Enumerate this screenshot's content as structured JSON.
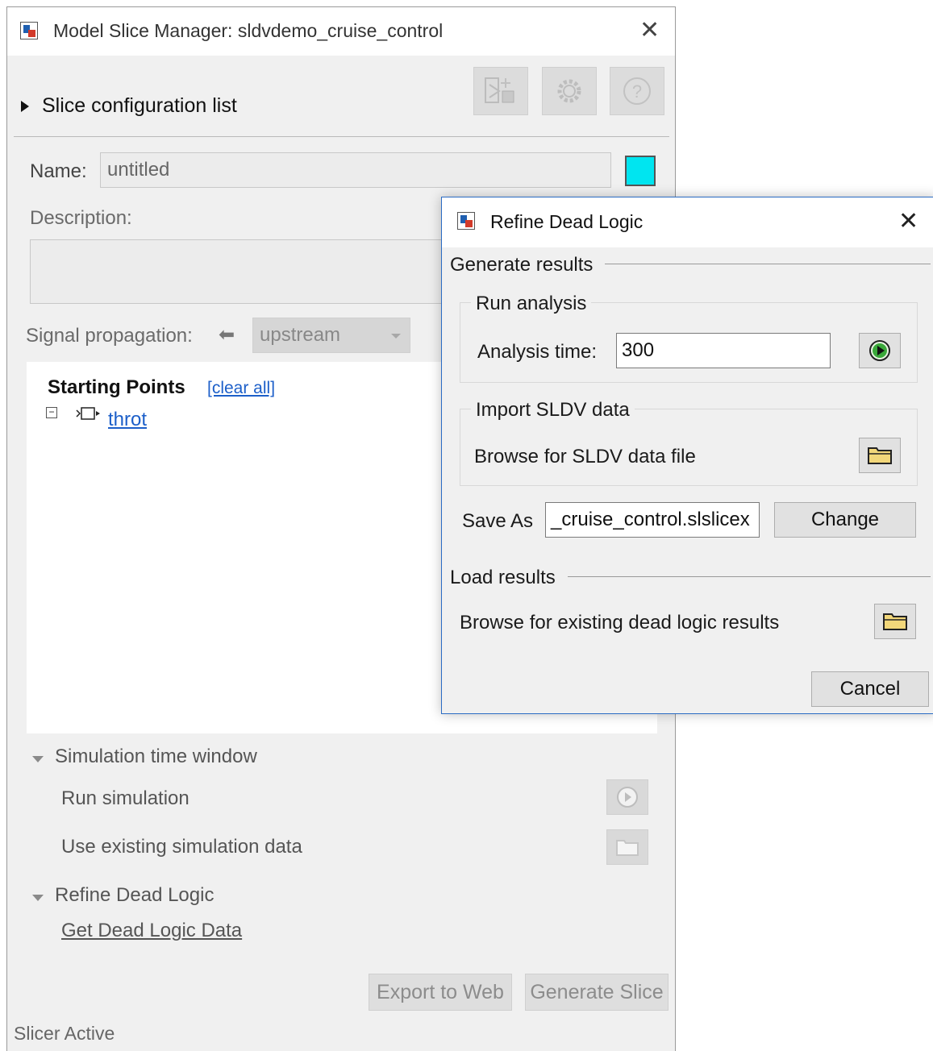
{
  "main_window": {
    "title": "Model Slice Manager: sldvdemo_cruise_control",
    "slice_config_label": "Slice configuration list",
    "name_label": "Name:",
    "name_value": "untitled",
    "name_color": "#00e5f0",
    "description_label": "Description:",
    "signal_propagation_label": "Signal propagation:",
    "signal_propagation_value": "upstream",
    "starting_points_title": "Starting Points",
    "clear_all_link": "[clear all]",
    "starting_points_items": [
      "throt"
    ],
    "sim_window_header": "Simulation time window",
    "run_simulation_label": "Run simulation",
    "use_existing_sim_label": "Use existing simulation data",
    "refine_dead_logic_header": "Refine Dead Logic",
    "get_dead_logic_link": "Get Dead Logic Data",
    "export_button": "Export to Web",
    "generate_button": "Generate Slice",
    "status_text": "Slicer Active",
    "toolbar_icons": [
      "slice-highlight-icon",
      "settings-gear-icon",
      "help-icon"
    ]
  },
  "dialog": {
    "title": "Refine Dead Logic",
    "generate_results_header": "Generate results",
    "run_analysis_header": "Run analysis",
    "analysis_time_label": "Analysis time:",
    "analysis_time_value": "300",
    "import_sldv_header": "Import SLDV data",
    "browse_sldv_label": "Browse for SLDV data file",
    "save_as_label": "Save As",
    "save_as_value": "_cruise_control.slslicex",
    "change_button": "Change",
    "load_results_header": "Load results",
    "browse_existing_label": "Browse for existing dead logic results",
    "cancel_button": "Cancel"
  },
  "colors": {
    "accent_border": "#2b6cc4",
    "link": "#1c5fc9",
    "run_icon": "#2a9a2a",
    "folder_icon": "#f2d77a"
  }
}
